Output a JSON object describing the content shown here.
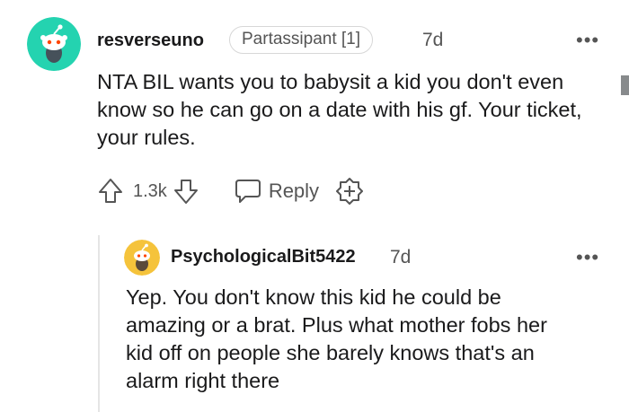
{
  "comment": {
    "username": "resverseuno",
    "flair": "Partassipant [1]",
    "age": "7d",
    "body": "NTA BIL wants you to babysit a kid you don't even know so he can go on a date with his gf. Your ticket, your rules.",
    "vote_count": "1.3k",
    "reply_label": "Reply",
    "more_label": "•••",
    "avatar_color": "#24d3b0"
  },
  "reply": {
    "username": "PsychologicalBit5422",
    "age": "7d",
    "body": "Yep. You don't know this kid he could be amazing or a brat. Plus what mother fobs her kid off on people she barely knows that's an alarm right there",
    "more_label": "•••",
    "avatar_color": "#f5c33b"
  },
  "icons": {
    "upvote": "arrow-up-outline",
    "downvote": "arrow-down-outline",
    "reply": "speech-bubble-outline",
    "award": "plus-badge-outline",
    "more": "horizontal-ellipsis"
  }
}
